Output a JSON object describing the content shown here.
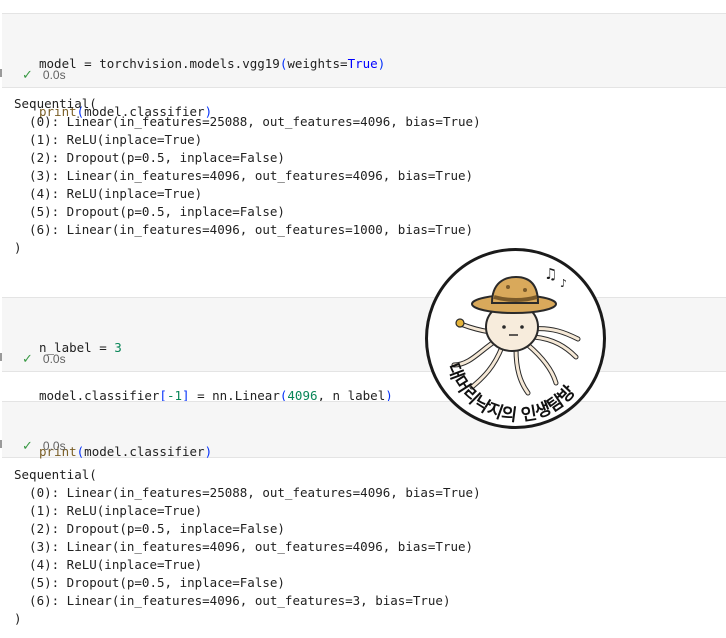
{
  "cells": [
    {
      "lines": [
        [
          {
            "t": "model = torchvision.models.vgg19",
            "c": "plain"
          },
          {
            "t": "(",
            "c": "br"
          },
          {
            "t": "weights=",
            "c": "plain"
          },
          {
            "t": "True",
            "c": "kw"
          },
          {
            "t": ")",
            "c": "br"
          }
        ],
        [
          {
            "t": "print",
            "c": "fn"
          },
          {
            "t": "(",
            "c": "br"
          },
          {
            "t": "model.classifier",
            "c": "plain"
          },
          {
            "t": ")",
            "c": "br"
          }
        ]
      ],
      "time": "0.0s",
      "output": [
        "Sequential(",
        "  (0): Linear(in_features=25088, out_features=4096, bias=True)",
        "  (1): ReLU(inplace=True)",
        "  (2): Dropout(p=0.5, inplace=False)",
        "  (3): Linear(in_features=4096, out_features=4096, bias=True)",
        "  (4): ReLU(inplace=True)",
        "  (5): Dropout(p=0.5, inplace=False)",
        "  (6): Linear(in_features=4096, out_features=1000, bias=True)",
        ")"
      ]
    },
    {
      "lines": [
        [
          {
            "t": "n_label = ",
            "c": "plain"
          },
          {
            "t": "3",
            "c": "num"
          }
        ],
        [
          {
            "t": "model.classifier",
            "c": "plain"
          },
          {
            "t": "[",
            "c": "br"
          },
          {
            "t": "-1",
            "c": "num"
          },
          {
            "t": "]",
            "c": "br"
          },
          {
            "t": " = nn.Linear",
            "c": "plain"
          },
          {
            "t": "(",
            "c": "br"
          },
          {
            "t": "4096",
            "c": "num"
          },
          {
            "t": ", n_label",
            "c": "plain"
          },
          {
            "t": ")",
            "c": "br"
          }
        ]
      ],
      "time": "0.0s",
      "output": []
    },
    {
      "lines": [
        [
          {
            "t": "print",
            "c": "fn"
          },
          {
            "t": "(",
            "c": "br"
          },
          {
            "t": "model.classifier",
            "c": "plain"
          },
          {
            "t": ")",
            "c": "br"
          }
        ]
      ],
      "time": "0.0s",
      "output": [
        "Sequential(",
        "  (0): Linear(in_features=25088, out_features=4096, bias=True)",
        "  (1): ReLU(inplace=True)",
        "  (2): Dropout(p=0.5, inplace=False)",
        "  (3): Linear(in_features=4096, out_features=4096, bias=True)",
        "  (4): ReLU(inplace=True)",
        "  (5): Dropout(p=0.5, inplace=False)",
        "  (6): Linear(in_features=4096, out_features=3, bias=True)",
        ")"
      ]
    }
  ],
  "status_icon": "check-icon",
  "colors": {
    "success": "#3a9a45",
    "cell_bg": "#f6f6f6"
  },
  "watermark": {
    "text": "대머리낙지의 인생탐방",
    "music_icon": "music-notes-icon"
  }
}
